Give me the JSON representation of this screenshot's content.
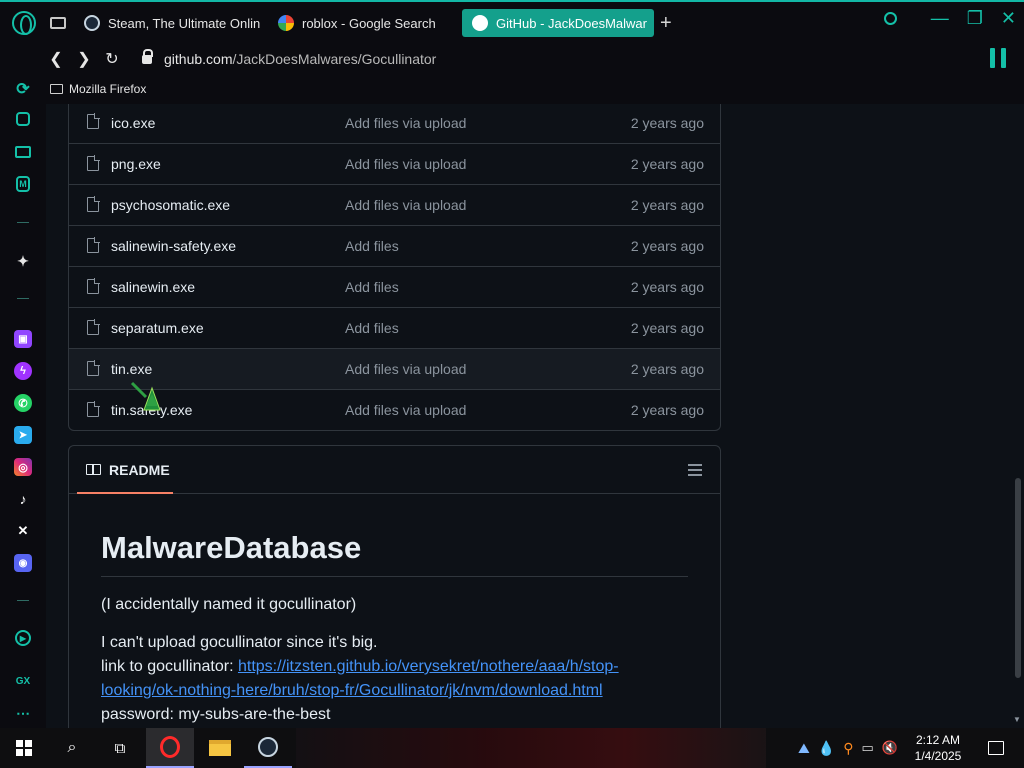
{
  "browser": {
    "tabs": [
      {
        "label": "Steam, The Ultimate Online",
        "icon": "steam-icon"
      },
      {
        "label": "roblox - Google Search",
        "icon": "google-icon"
      },
      {
        "label": "GitHub - JackDoesMalwar",
        "icon": "github-icon",
        "active": true
      }
    ],
    "new_tab": "+",
    "address": {
      "domain": "github.com",
      "path": "/JackDoesMalwares/Gocullinator"
    },
    "bookmark_folder": "Mozilla Firefox",
    "accent_color": "#14c0a8"
  },
  "files": [
    {
      "name": "ico.exe",
      "message": "Add files via upload",
      "date": "2 years ago"
    },
    {
      "name": "png.exe",
      "message": "Add files via upload",
      "date": "2 years ago"
    },
    {
      "name": "psychosomatic.exe",
      "message": "Add files via upload",
      "date": "2 years ago"
    },
    {
      "name": "salinewin-safety.exe",
      "message": "Add files",
      "date": "2 years ago"
    },
    {
      "name": "salinewin.exe",
      "message": "Add files",
      "date": "2 years ago"
    },
    {
      "name": "separatum.exe",
      "message": "Add files",
      "date": "2 years ago"
    },
    {
      "name": "tin.exe",
      "message": "Add files via upload",
      "date": "2 years ago"
    },
    {
      "name": "tin.safety.exe",
      "message": "Add files via upload",
      "date": "2 years ago"
    }
  ],
  "readme": {
    "tab_label": "README",
    "heading": "MalwareDatabase",
    "line1": "(I accidentally named it gocullinator)",
    "line2": "I can't upload gocullinator since it's big.",
    "link_prefix": "link to gocullinator: ",
    "link_text_1": "https://itzsten.github.io/verysekret/nothere/aaa/h/stop-",
    "link_text_2": "looking/ok-nothing-here/bruh/stop-fr/Gocullinator/jk/nvm/download.html",
    "password_line": "password: my-subs-are-the-best"
  },
  "taskbar": {
    "time": "2:12 AM",
    "date": "1/4/2025"
  }
}
